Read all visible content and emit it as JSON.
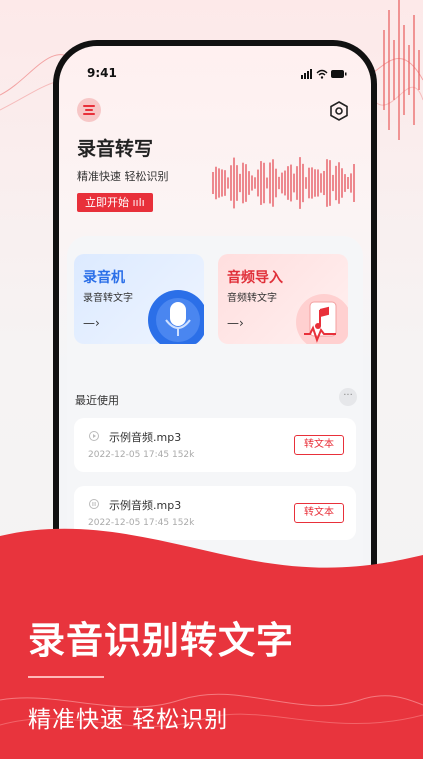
{
  "status_bar": {
    "time": "9:41"
  },
  "header": {
    "title": "录音转写",
    "subtitle": "精准快速 轻松识别",
    "start_label": "立即开始"
  },
  "features": [
    {
      "title": "录音机",
      "subtitle": "录音转文字",
      "arrow": "—›",
      "accent": "#2b6fe8",
      "icon": "microphone-icon"
    },
    {
      "title": "音频导入",
      "subtitle": "音频转文字",
      "arrow": "—›",
      "accent": "#e0303a",
      "icon": "audio-file-icon"
    }
  ],
  "recent": {
    "title": "最近使用",
    "more": "···",
    "items": [
      {
        "name": "示例音频.mp3",
        "meta": "2022-12-05 17:45 152k",
        "action": "转文本",
        "state": "play-icon"
      },
      {
        "name": "示例音频.mp3",
        "meta": "2022-12-05 17:45 152k",
        "action": "转文本",
        "state": "pause-icon"
      }
    ]
  },
  "promo": {
    "title": "录音识别转文字",
    "subtitle": "精准快速 轻松识别"
  },
  "colors": {
    "brand_red": "#e8303a",
    "blue_accent": "#2b6fe8"
  }
}
